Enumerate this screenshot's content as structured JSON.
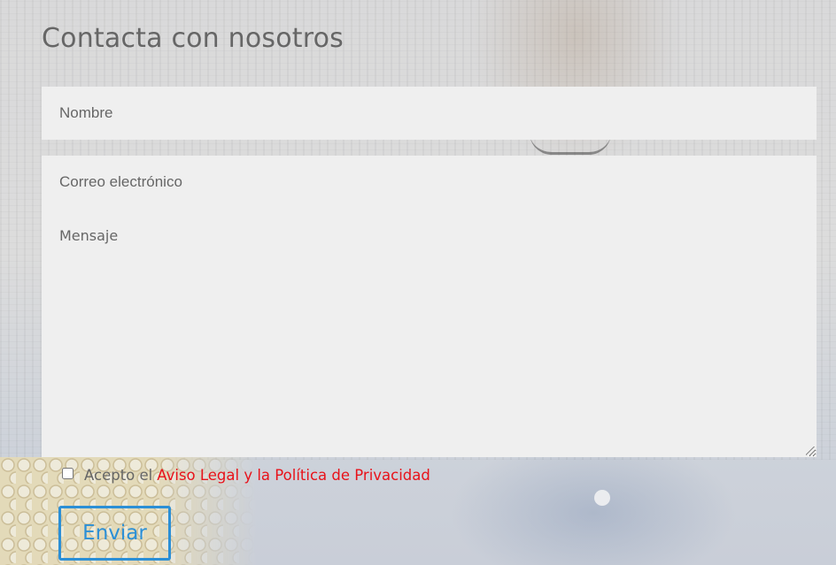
{
  "contact_form": {
    "title": "Contacta con nosotros",
    "name_placeholder": "Nombre",
    "email_placeholder": "Correo electrónico",
    "message_placeholder": "Mensaje",
    "consent_prefix": "Acepto el",
    "consent_link_text": "Aviso Legal y la Política de Privacidad",
    "submit_label": "Enviar"
  },
  "colors": {
    "title_text": "#666666",
    "field_background": "#efefef",
    "link": "#e8121a",
    "button_accent": "#2b8fd6"
  }
}
